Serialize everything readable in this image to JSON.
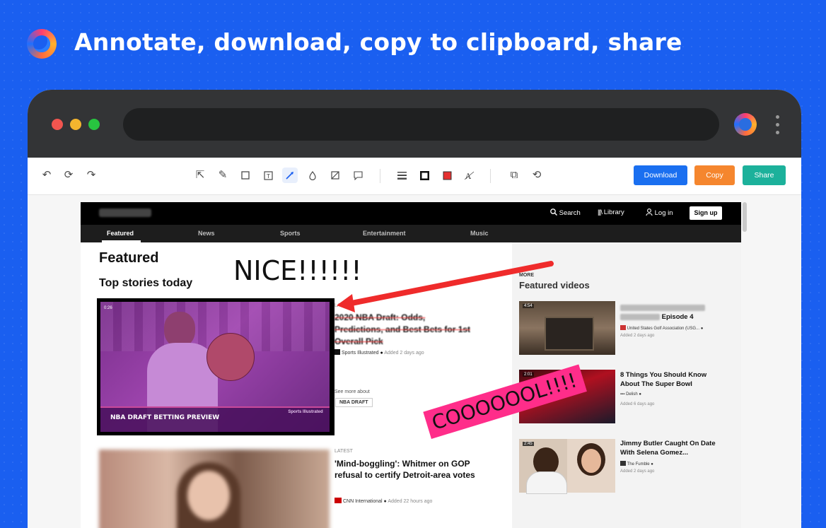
{
  "headline": "Annotate, download, copy to clipboard, share",
  "toolbar": {
    "buttons": {
      "download": "Download",
      "copy": "Copy",
      "share": "Share"
    },
    "colors": {
      "download": "#1a6ff0",
      "copy": "#f5862e",
      "share": "#1cb19b",
      "selected_color": "#e53030"
    }
  },
  "site": {
    "header": {
      "search": "Search",
      "library": "Library",
      "login": "Log in",
      "signup": "Sign up"
    },
    "nav": [
      "Featured",
      "News",
      "Sports",
      "Entertainment",
      "Music"
    ],
    "featured_heading": "Featured",
    "top_stories": "Top stories today",
    "story1": {
      "badge": "LATEST",
      "video_time": "0:26",
      "video_caption": "NBA DRAFT BETTING PREVIEW",
      "video_logo": "Sports Illustrated",
      "title": "2020 NBA Draft: Odds, Predictions, and Best Bets for 1st Overall Pick",
      "source": "Sports Illustrated",
      "added": "Added 2 days ago",
      "see_more": "See more about",
      "tag": "NBA DRAFT"
    },
    "story2": {
      "badge": "LATEST",
      "title": "'Mind-boggling': Whitmer on GOP refusal to certify Detroit-area votes",
      "source": "CNN International",
      "added": "Added 22 hours ago"
    },
    "sidebar": {
      "more": "MORE",
      "heading": "Featured videos",
      "videos": [
        {
          "time": "4:54",
          "title_visible": "Episode 4",
          "source": "United States Golf Association (USG...",
          "added": "Added 2 days ago"
        },
        {
          "time": "2:01",
          "title": "8 Things You Should Know About The Super Bowl",
          "source": "Delish",
          "added": "Added 6 days ago"
        },
        {
          "time": "2:45",
          "title": "Jimmy Butler Caught On Date With Selena Gomez...",
          "source": "The Fumble",
          "added": "Added 2 days ago"
        }
      ]
    }
  },
  "annotations": {
    "nice": "NICE!!!!!!",
    "cool": "COOOOOOL!!!!",
    "arrow_color": "#ef2b2b",
    "highlight_color": "#ff2d8a"
  }
}
